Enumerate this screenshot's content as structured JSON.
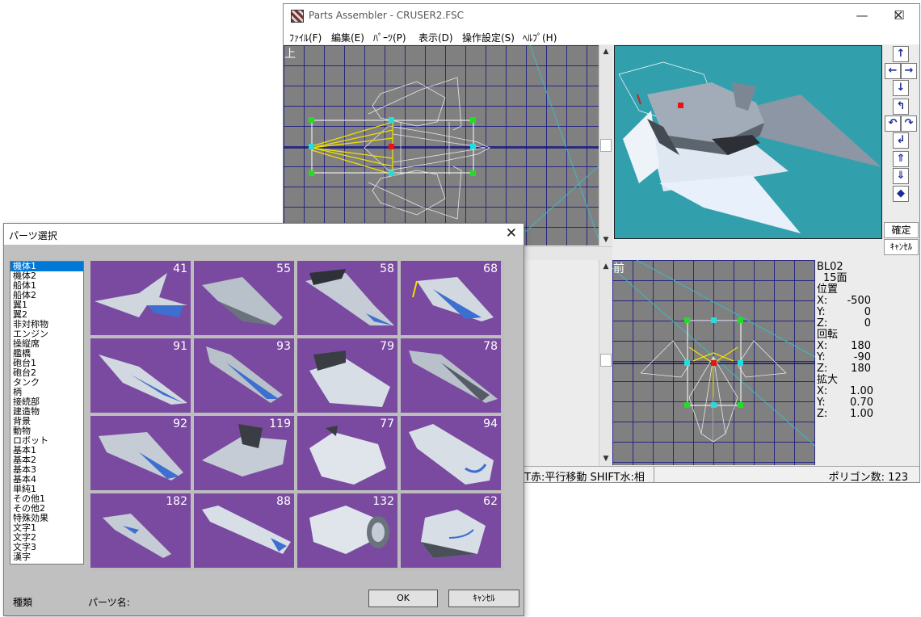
{
  "window": {
    "title": "Parts Assembler - CRUSER2.FSC",
    "controls": {
      "minimize": "—",
      "maximize": "☐",
      "close": "✕"
    }
  },
  "menu": [
    "ﾌｧｲﾙ(F)",
    "編集(E)",
    "ﾊﾟｰﾂ(P)",
    "表示(D)",
    "操作設定(S)",
    "ﾍﾙﾌﾟ(H)"
  ],
  "viewports": {
    "top_label": "上",
    "front_label": "前"
  },
  "nav_buttons": {
    "icons": [
      "up-arrow-icon",
      "left-arrow-icon",
      "right-arrow-icon",
      "down-arrow-icon",
      "rotate-up-icon",
      "rotate-left-icon",
      "rotate-right-icon",
      "rotate-down-icon",
      "move-forward-icon",
      "move-back-icon",
      "diamond-icon"
    ],
    "glyphs": [
      "↑",
      "←",
      "→",
      "↓",
      "↰",
      "↶",
      "↷",
      "↲",
      "⇑",
      "⇓",
      "◆"
    ],
    "confirm": "確定",
    "cancel": "ｷｬﾝｾﾙ"
  },
  "info": {
    "part_id": "BL02",
    "faces": "15面",
    "position_label": "位置",
    "position": {
      "x": "-500",
      "y": "0",
      "z": "0"
    },
    "rotation_label": "回転",
    "rotation": {
      "x": "180",
      "y": "-90",
      "z": "180"
    },
    "scale_label": "拡大",
    "scale": {
      "x": "1.00",
      "y": "0.70",
      "z": "1.00"
    },
    "axis_x": "X:",
    "axis_y": "Y:",
    "axis_z": "Z:"
  },
  "status": {
    "hint": "T赤:平行移動 SHIFT水:相",
    "polygon_count": "ポリゴン数: 123"
  },
  "dialog": {
    "title": "パーツ選択",
    "close": "✕",
    "categories": [
      "機体1",
      "機体2",
      "船体1",
      "船体2",
      "翼1",
      "翼2",
      "非対称物",
      "エンジン",
      "操縦席",
      "艦橋",
      "砲台1",
      "砲台2",
      "タンク",
      "柄",
      "接続部",
      "建造物",
      "背景",
      "動物",
      "ロボット",
      "基本1",
      "基本2",
      "基本3",
      "基本4",
      "単純1",
      "その他1",
      "その他2",
      "特殊効果",
      "文字1",
      "文字2",
      "文字3",
      "漢字"
    ],
    "selected_category": 0,
    "parts": [
      "41",
      "55",
      "58",
      "68",
      "91",
      "93",
      "79",
      "78",
      "92",
      "119",
      "77",
      "94",
      "182",
      "88",
      "132",
      "62"
    ],
    "kind_label": "種類",
    "part_name_label": "パーツ名:",
    "ok": "OK",
    "cancel": "ｷｬﾝｾﾙ"
  },
  "colors": {
    "viewport_bg": "#808080",
    "grid": "#1e1e82",
    "preview_bg": "#32a0ac",
    "tile_bg": "#7a4aa0",
    "selection": "#0078d7"
  }
}
